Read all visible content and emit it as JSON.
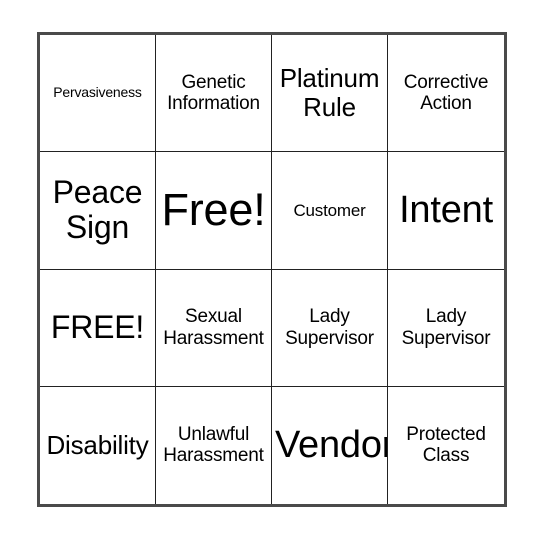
{
  "card": {
    "columns": 4,
    "rows": 4,
    "border_color": "#4a4a4a",
    "grid_line_color": "#222222",
    "background_color": "#ffffff",
    "text_color": "#000000",
    "cells": [
      {
        "text": "Pervasiveness",
        "size": "sz-xs",
        "free": false
      },
      {
        "text": "Genetic\nInformation",
        "size": "sz-m",
        "free": false
      },
      {
        "text": "Platinum\nRule",
        "size": "sz-l",
        "free": false
      },
      {
        "text": "Corrective\nAction",
        "size": "sz-m",
        "free": false
      },
      {
        "text": "Peace\nSign",
        "size": "sz-xl",
        "free": false
      },
      {
        "text": "Free!",
        "size": "sz-huge",
        "free": true
      },
      {
        "text": "Customer",
        "size": "sz-s",
        "free": false
      },
      {
        "text": "Intent",
        "size": "sz-xxl",
        "free": false
      },
      {
        "text": "FREE!",
        "size": "sz-xl",
        "free": true
      },
      {
        "text": "Sexual\nHarassment",
        "size": "sz-m",
        "free": false
      },
      {
        "text": "Lady\nSupervisor",
        "size": "sz-m",
        "free": false
      },
      {
        "text": "Lady\nSupervisor",
        "size": "sz-m",
        "free": false
      },
      {
        "text": "Disability",
        "size": "sz-l",
        "free": false
      },
      {
        "text": "Unlawful\nHarassment",
        "size": "sz-m",
        "free": false
      },
      {
        "text": "Vendor",
        "size": "sz-xxl",
        "free": false
      },
      {
        "text": "Protected\nClass",
        "size": "sz-m",
        "free": false
      }
    ]
  }
}
